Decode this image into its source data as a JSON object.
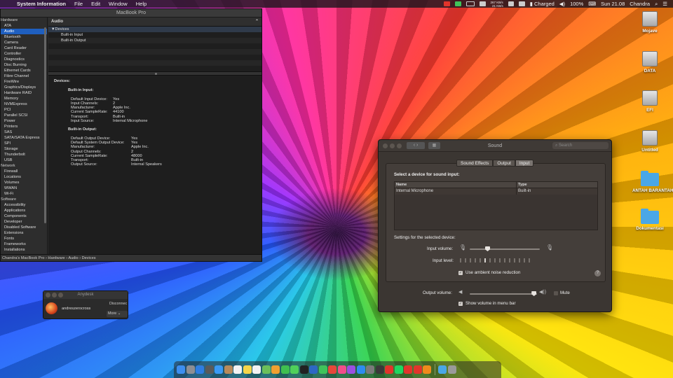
{
  "menubar": {
    "app": "System Information",
    "menus": [
      "File",
      "Edit",
      "Window",
      "Help"
    ],
    "net_up": "267 KB/s",
    "net_down": "21 KB/s",
    "battery_status": "Charged",
    "volume_percent": "100%",
    "clock": "Sun 21.08",
    "user": "Chandra"
  },
  "sysinfo": {
    "title": "MacBook Pro",
    "sidebar": [
      {
        "label": "Hardware",
        "cat": true
      },
      {
        "label": "ATA"
      },
      {
        "label": "Audio",
        "selected": true
      },
      {
        "label": "Bluetooth"
      },
      {
        "label": "Camera"
      },
      {
        "label": "Card Reader"
      },
      {
        "label": "Controller"
      },
      {
        "label": "Diagnostics"
      },
      {
        "label": "Disc Burning"
      },
      {
        "label": "Ethernet Cards"
      },
      {
        "label": "Fibre Channel"
      },
      {
        "label": "FireWire"
      },
      {
        "label": "Graphics/Displays"
      },
      {
        "label": "Hardware RAID"
      },
      {
        "label": "Memory"
      },
      {
        "label": "NVMExpress"
      },
      {
        "label": "PCI"
      },
      {
        "label": "Parallel SCSI"
      },
      {
        "label": "Power"
      },
      {
        "label": "Printers"
      },
      {
        "label": "SAS"
      },
      {
        "label": "SATA/SATA Express"
      },
      {
        "label": "SPI"
      },
      {
        "label": "Storage"
      },
      {
        "label": "Thunderbolt"
      },
      {
        "label": "USB"
      },
      {
        "label": "Network",
        "cat": true
      },
      {
        "label": "Firewall"
      },
      {
        "label": "Locations"
      },
      {
        "label": "Volumes"
      },
      {
        "label": "WWAN"
      },
      {
        "label": "Wi-Fi"
      },
      {
        "label": "Software",
        "cat": true
      },
      {
        "label": "Accessibility"
      },
      {
        "label": "Applications"
      },
      {
        "label": "Components"
      },
      {
        "label": "Developer"
      },
      {
        "label": "Disabled Software"
      },
      {
        "label": "Extensions"
      },
      {
        "label": "Fonts"
      },
      {
        "label": "Frameworks"
      },
      {
        "label": "Installations"
      }
    ],
    "column_header": "Audio",
    "tree": {
      "group": "Devices",
      "items": [
        "Built-in Input",
        "Built-in Output"
      ]
    },
    "detail": {
      "heading": "Devices:",
      "input_title": "Built-in Input:",
      "input": [
        [
          "Default Input Device:",
          "Yes"
        ],
        [
          "Input Channels:",
          "2"
        ],
        [
          "Manufacturer:",
          "Apple Inc."
        ],
        [
          "Current SampleRate:",
          "44100"
        ],
        [
          "Transport:",
          "Built-in"
        ],
        [
          "Input Source:",
          "Internal Microphone"
        ]
      ],
      "output_title": "Built-in Output:",
      "output": [
        [
          "Default Output Device:",
          "Yes"
        ],
        [
          "Default System Output Device:",
          "Yes"
        ],
        [
          "Manufacturer:",
          "Apple Inc."
        ],
        [
          "Output Channels:",
          "2"
        ],
        [
          "Current SampleRate:",
          "48000"
        ],
        [
          "Transport:",
          "Built-in"
        ],
        [
          "Output Source:",
          "Internal Speakers"
        ]
      ]
    },
    "path": "Chandra's MacBook Pro › Hardware › Audio › Devices"
  },
  "sound": {
    "title": "Sound",
    "search_placeholder": "Search",
    "tabs": [
      "Sound Effects",
      "Output",
      "Input"
    ],
    "selected_tab": "Input",
    "select_label": "Select a device for sound input:",
    "table_headers": [
      "Name",
      "Type"
    ],
    "table_rows": [
      [
        "Internal Microphone",
        "Built-in"
      ]
    ],
    "settings_label": "Settings for the selected device:",
    "input_volume_label": "Input volume:",
    "input_volume_level": 0.25,
    "input_level_label": "Input level:",
    "input_level_bars_total": 15,
    "input_level_bars_on": [
      5
    ],
    "noise_reduction_label": "Use ambient noise reduction",
    "noise_reduction_checked": true,
    "help": "?",
    "output_volume_label": "Output volume:",
    "output_volume_level": 0.95,
    "mute_label": "Mute",
    "mute_checked": false,
    "show_volume_label": "Show volume in menu bar",
    "show_volume_checked": true
  },
  "anydesk": {
    "title": "Anydesk",
    "user": "andreszerocross",
    "status": "Disconnec",
    "more": "More"
  },
  "desktop_icons": [
    {
      "label": "Mojave",
      "kind": "drive"
    },
    {
      "label": "DATA",
      "kind": "drive"
    },
    {
      "label": "EFI",
      "kind": "drive"
    },
    {
      "label": "Untitled",
      "kind": "drive"
    },
    {
      "label": "ANTAH BARANTAH",
      "kind": "folder"
    },
    {
      "label": "Dokumentasi",
      "kind": "folder"
    }
  ],
  "dock": {
    "apps": [
      {
        "name": "finder",
        "color": "#3d8ef0"
      },
      {
        "name": "launchpad",
        "color": "#8e8e93"
      },
      {
        "name": "safari",
        "color": "#2f7de1"
      },
      {
        "name": "compass",
        "color": "#5a5a5a"
      },
      {
        "name": "mail",
        "color": "#3a9af5"
      },
      {
        "name": "contacts",
        "color": "#b88a5a"
      },
      {
        "name": "calendar",
        "color": "#f2f2f2"
      },
      {
        "name": "notes",
        "color": "#f6d54a"
      },
      {
        "name": "reminders",
        "color": "#f2f2f2"
      },
      {
        "name": "maps",
        "color": "#6bbf5a"
      },
      {
        "name": "photos",
        "color": "#f0a030"
      },
      {
        "name": "facetime",
        "color": "#3fbf4f"
      },
      {
        "name": "messages",
        "color": "#4fd05a"
      },
      {
        "name": "terminal",
        "color": "#222222"
      },
      {
        "name": "sourcetree",
        "color": "#2d68c4"
      },
      {
        "name": "whatsapp",
        "color": "#3fc35a"
      },
      {
        "name": "chrome",
        "color": "#e5473a"
      },
      {
        "name": "itunes",
        "color": "#f24d8a"
      },
      {
        "name": "podcasts",
        "color": "#9a4fe0"
      },
      {
        "name": "app-store",
        "color": "#2d8cf0"
      },
      {
        "name": "system-preferences",
        "color": "#7a7a7a"
      },
      {
        "name": "activity-monitor",
        "color": "#3a3a3a"
      },
      {
        "name": "anydesk",
        "color": "#e2342b"
      },
      {
        "name": "spotify",
        "color": "#1ed760"
      },
      {
        "name": "anydesk-2",
        "color": "#e2342b"
      },
      {
        "name": "anydesk-3",
        "color": "#e2342b"
      },
      {
        "name": "vlc",
        "color": "#f08a1c"
      }
    ],
    "extras": [
      {
        "name": "downloads-folder",
        "color": "#4aa7e6"
      },
      {
        "name": "trash",
        "color": "#9a9a9a"
      }
    ]
  }
}
